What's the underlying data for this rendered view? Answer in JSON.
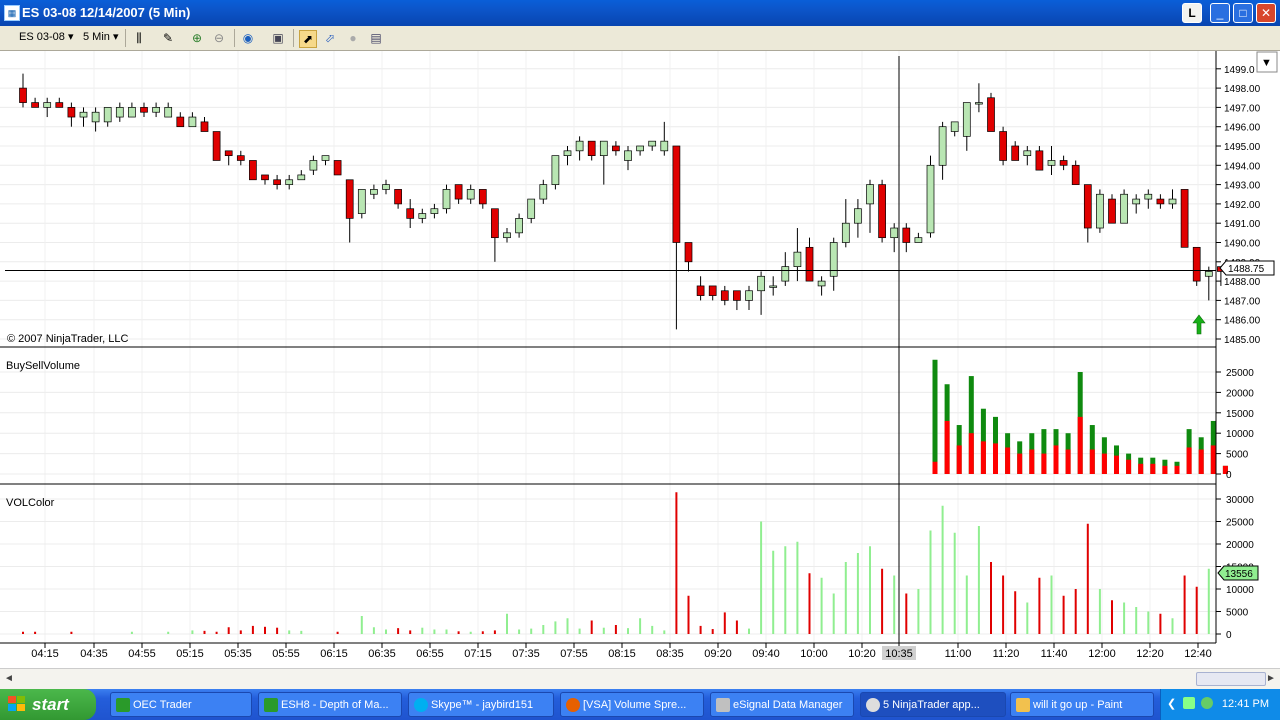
{
  "window": {
    "title": "ES 03-08  12/14/2007  (5 Min)",
    "l_button": "L",
    "minimize": "_",
    "maximize": "□",
    "close": "✕"
  },
  "toolbar": {
    "instrument": "ES 03-08",
    "interval": "5 Min",
    "icons": [
      "bar-type-icon",
      "pencil-icon",
      "zoom-in-icon",
      "zoom-out-icon",
      "globe-icon",
      "properties-icon",
      "data-box-icon",
      "indicators-icon",
      "strategies-icon",
      "grid-icon"
    ]
  },
  "chart": {
    "copyright": "© 2007 NinjaTrader, LLC",
    "price_label": "1488.75",
    "price_axis": [
      "1499.0",
      "1498.00",
      "1497.00",
      "1496.00",
      "1495.00",
      "1494.00",
      "1493.00",
      "1492.00",
      "1491.00",
      "1490.00",
      "1489.00",
      "1488.00",
      "1487.00",
      "1486.00",
      "1485.00"
    ],
    "time_axis": [
      "04:15",
      "04:35",
      "04:55",
      "05:15",
      "05:35",
      "05:55",
      "06:15",
      "06:35",
      "06:55",
      "07:15",
      "07:35",
      "07:55",
      "08:15",
      "08:35",
      "09:20",
      "09:40",
      "10:00",
      "10:20",
      "10:35",
      "11:00",
      "11:20",
      "11:40",
      "12:00",
      "12:20",
      "12:40"
    ],
    "cursor_time": "10:35",
    "panels": {
      "buysell": {
        "label": "BuySellVolume",
        "axis": [
          "25000",
          "20000",
          "15000",
          "10000",
          "5000",
          "0"
        ]
      },
      "volcolor": {
        "label": "VOLColor",
        "axis": [
          "30000",
          "25000",
          "20000",
          "15000",
          "10000",
          "5000",
          "0"
        ],
        "value_label": "13556"
      }
    },
    "colors": {
      "up": "#b9e6b3",
      "down": "#e00000",
      "vol_green": "#90ee90",
      "buy": "#0f8a0f",
      "sell": "#ff0000"
    }
  },
  "chart_data": [
    {
      "type": "candlestick",
      "title": "ES 03-08  12/14/2007  (5 Min)",
      "candles": [
        {
          "o": 1498.0,
          "h": 1498.75,
          "l": 1497.0,
          "c": 1497.25
        },
        {
          "o": 1497.25,
          "h": 1497.5,
          "l": 1497.0,
          "c": 1497.0
        },
        {
          "o": 1497.0,
          "h": 1497.5,
          "l": 1496.5,
          "c": 1497.25
        },
        {
          "o": 1497.25,
          "h": 1497.5,
          "l": 1497.0,
          "c": 1497.0
        },
        {
          "o": 1497.0,
          "h": 1497.25,
          "l": 1496.0,
          "c": 1496.5
        },
        {
          "o": 1496.5,
          "h": 1497.0,
          "l": 1496.0,
          "c": 1496.75
        },
        {
          "o": 1496.25,
          "h": 1497.0,
          "l": 1495.75,
          "c": 1496.75
        },
        {
          "o": 1496.25,
          "h": 1497.0,
          "l": 1496.0,
          "c": 1497.0
        },
        {
          "o": 1496.5,
          "h": 1497.25,
          "l": 1496.25,
          "c": 1497.0
        },
        {
          "o": 1496.5,
          "h": 1497.25,
          "l": 1496.5,
          "c": 1497.0
        },
        {
          "o": 1497.0,
          "h": 1497.25,
          "l": 1496.5,
          "c": 1496.75
        },
        {
          "o": 1496.75,
          "h": 1497.25,
          "l": 1496.5,
          "c": 1497.0
        },
        {
          "o": 1496.5,
          "h": 1497.25,
          "l": 1496.5,
          "c": 1497.0
        },
        {
          "o": 1496.5,
          "h": 1496.75,
          "l": 1496.0,
          "c": 1496.0
        },
        {
          "o": 1496.0,
          "h": 1496.75,
          "l": 1496.0,
          "c": 1496.5
        },
        {
          "o": 1496.25,
          "h": 1496.5,
          "l": 1495.75,
          "c": 1495.75
        },
        {
          "o": 1495.75,
          "h": 1495.75,
          "l": 1494.25,
          "c": 1494.25
        },
        {
          "o": 1494.75,
          "h": 1494.75,
          "l": 1494.0,
          "c": 1494.5
        },
        {
          "o": 1494.5,
          "h": 1494.75,
          "l": 1494.0,
          "c": 1494.25
        },
        {
          "o": 1494.25,
          "h": 1494.25,
          "l": 1493.25,
          "c": 1493.25
        },
        {
          "o": 1493.5,
          "h": 1493.5,
          "l": 1493.0,
          "c": 1493.25
        },
        {
          "o": 1493.25,
          "h": 1493.5,
          "l": 1492.75,
          "c": 1493.0
        },
        {
          "o": 1493.0,
          "h": 1493.5,
          "l": 1492.75,
          "c": 1493.25
        },
        {
          "o": 1493.25,
          "h": 1493.75,
          "l": 1493.25,
          "c": 1493.5
        },
        {
          "o": 1493.75,
          "h": 1494.5,
          "l": 1493.5,
          "c": 1494.25
        },
        {
          "o": 1494.25,
          "h": 1494.5,
          "l": 1494.0,
          "c": 1494.5
        },
        {
          "o": 1494.25,
          "h": 1494.25,
          "l": 1493.5,
          "c": 1493.5
        },
        {
          "o": 1493.25,
          "h": 1493.25,
          "l": 1490.0,
          "c": 1491.25
        },
        {
          "o": 1491.5,
          "h": 1492.75,
          "l": 1491.25,
          "c": 1492.75
        },
        {
          "o": 1492.5,
          "h": 1493.0,
          "l": 1492.25,
          "c": 1492.75
        },
        {
          "o": 1492.75,
          "h": 1493.25,
          "l": 1492.5,
          "c": 1493.0
        },
        {
          "o": 1492.75,
          "h": 1492.75,
          "l": 1491.75,
          "c": 1492.0
        },
        {
          "o": 1491.75,
          "h": 1492.25,
          "l": 1490.75,
          "c": 1491.25
        },
        {
          "o": 1491.25,
          "h": 1491.75,
          "l": 1491.0,
          "c": 1491.5
        },
        {
          "o": 1491.5,
          "h": 1492.0,
          "l": 1491.25,
          "c": 1491.75
        },
        {
          "o": 1491.75,
          "h": 1493.0,
          "l": 1491.5,
          "c": 1492.75
        },
        {
          "o": 1493.0,
          "h": 1493.0,
          "l": 1492.0,
          "c": 1492.25
        },
        {
          "o": 1492.25,
          "h": 1493.0,
          "l": 1492.0,
          "c": 1492.75
        },
        {
          "o": 1492.75,
          "h": 1492.75,
          "l": 1491.75,
          "c": 1492.0
        },
        {
          "o": 1491.75,
          "h": 1491.75,
          "l": 1489.0,
          "c": 1490.25
        },
        {
          "o": 1490.25,
          "h": 1490.75,
          "l": 1490.0,
          "c": 1490.5
        },
        {
          "o": 1490.5,
          "h": 1491.5,
          "l": 1490.25,
          "c": 1491.25
        },
        {
          "o": 1491.25,
          "h": 1492.25,
          "l": 1491.0,
          "c": 1492.25
        },
        {
          "o": 1492.25,
          "h": 1493.25,
          "l": 1492.0,
          "c": 1493.0
        },
        {
          "o": 1493.0,
          "h": 1494.5,
          "l": 1492.75,
          "c": 1494.5
        },
        {
          "o": 1494.5,
          "h": 1495.0,
          "l": 1494.0,
          "c": 1494.75
        },
        {
          "o": 1494.75,
          "h": 1495.5,
          "l": 1494.25,
          "c": 1495.25
        },
        {
          "o": 1495.25,
          "h": 1495.25,
          "l": 1494.25,
          "c": 1494.5
        },
        {
          "o": 1494.5,
          "h": 1495.25,
          "l": 1493.0,
          "c": 1495.25
        },
        {
          "o": 1495.0,
          "h": 1495.25,
          "l": 1494.5,
          "c": 1494.75
        },
        {
          "o": 1494.25,
          "h": 1495.0,
          "l": 1493.75,
          "c": 1494.75
        },
        {
          "o": 1494.75,
          "h": 1495.0,
          "l": 1494.5,
          "c": 1495.0
        },
        {
          "o": 1495.0,
          "h": 1495.25,
          "l": 1494.75,
          "c": 1495.25
        },
        {
          "o": 1494.75,
          "h": 1496.25,
          "l": 1494.5,
          "c": 1495.25
        },
        {
          "o": 1495.0,
          "h": 1495.0,
          "l": 1485.5,
          "c": 1490.0
        },
        {
          "o": 1490.0,
          "h": 1490.0,
          "l": 1488.5,
          "c": 1489.0
        },
        {
          "o": 1487.75,
          "h": 1488.25,
          "l": 1487.0,
          "c": 1487.25
        },
        {
          "o": 1487.75,
          "h": 1487.75,
          "l": 1487.0,
          "c": 1487.25
        },
        {
          "o": 1487.5,
          "h": 1487.75,
          "l": 1486.75,
          "c": 1487.0
        },
        {
          "o": 1487.5,
          "h": 1487.5,
          "l": 1486.5,
          "c": 1487.0
        },
        {
          "o": 1487.0,
          "h": 1487.75,
          "l": 1486.5,
          "c": 1487.5
        },
        {
          "o": 1487.5,
          "h": 1488.5,
          "l": 1486.25,
          "c": 1488.25
        },
        {
          "o": 1487.75,
          "h": 1488.25,
          "l": 1487.25,
          "c": 1487.75
        },
        {
          "o": 1488.0,
          "h": 1489.5,
          "l": 1487.75,
          "c": 1488.75
        },
        {
          "o": 1488.75,
          "h": 1490.75,
          "l": 1488.0,
          "c": 1489.5
        },
        {
          "o": 1489.75,
          "h": 1490.25,
          "l": 1488.0,
          "c": 1488.0
        },
        {
          "o": 1487.75,
          "h": 1488.25,
          "l": 1487.25,
          "c": 1488.0
        },
        {
          "o": 1488.25,
          "h": 1490.25,
          "l": 1487.5,
          "c": 1490.0
        },
        {
          "o": 1490.0,
          "h": 1492.25,
          "l": 1489.75,
          "c": 1491.0
        },
        {
          "o": 1491.0,
          "h": 1492.25,
          "l": 1490.25,
          "c": 1491.75
        },
        {
          "o": 1492.0,
          "h": 1493.25,
          "l": 1490.5,
          "c": 1493.0
        },
        {
          "o": 1493.0,
          "h": 1493.25,
          "l": 1490.0,
          "c": 1490.25
        },
        {
          "o": 1490.25,
          "h": 1491.0,
          "l": 1489.5,
          "c": 1490.75
        },
        {
          "o": 1490.75,
          "h": 1491.0,
          "l": 1489.5,
          "c": 1490.0
        },
        {
          "o": 1490.0,
          "h": 1490.5,
          "l": 1490.0,
          "c": 1490.25
        },
        {
          "o": 1490.5,
          "h": 1494.5,
          "l": 1490.25,
          "c": 1494.0
        },
        {
          "o": 1494.0,
          "h": 1496.25,
          "l": 1493.25,
          "c": 1496.0
        },
        {
          "o": 1495.75,
          "h": 1496.25,
          "l": 1495.5,
          "c": 1496.25
        },
        {
          "o": 1495.5,
          "h": 1497.25,
          "l": 1494.75,
          "c": 1497.25
        },
        {
          "o": 1497.25,
          "h": 1498.25,
          "l": 1496.75,
          "c": 1497.25
        },
        {
          "o": 1497.5,
          "h": 1497.75,
          "l": 1495.75,
          "c": 1495.75
        },
        {
          "o": 1495.75,
          "h": 1496.0,
          "l": 1494.0,
          "c": 1494.25
        },
        {
          "o": 1495.0,
          "h": 1495.25,
          "l": 1494.25,
          "c": 1494.25
        },
        {
          "o": 1494.5,
          "h": 1495.0,
          "l": 1494.0,
          "c": 1494.75
        },
        {
          "o": 1494.75,
          "h": 1495.0,
          "l": 1493.75,
          "c": 1493.75
        },
        {
          "o": 1494.0,
          "h": 1495.0,
          "l": 1493.5,
          "c": 1494.25
        },
        {
          "o": 1494.25,
          "h": 1494.5,
          "l": 1493.75,
          "c": 1494.0
        },
        {
          "o": 1494.0,
          "h": 1494.25,
          "l": 1493.0,
          "c": 1493.0
        },
        {
          "o": 1493.0,
          "h": 1493.0,
          "l": 1490.0,
          "c": 1490.75
        },
        {
          "o": 1490.75,
          "h": 1492.75,
          "l": 1490.5,
          "c": 1492.5
        },
        {
          "o": 1492.25,
          "h": 1492.5,
          "l": 1491.0,
          "c": 1491.0
        },
        {
          "o": 1491.0,
          "h": 1492.75,
          "l": 1491.0,
          "c": 1492.5
        },
        {
          "o": 1492.0,
          "h": 1492.5,
          "l": 1491.5,
          "c": 1492.25
        },
        {
          "o": 1492.25,
          "h": 1492.75,
          "l": 1491.75,
          "c": 1492.5
        },
        {
          "o": 1492.25,
          "h": 1492.5,
          "l": 1491.75,
          "c": 1492.0
        },
        {
          "o": 1492.0,
          "h": 1492.75,
          "l": 1491.75,
          "c": 1492.25
        },
        {
          "o": 1492.75,
          "h": 1492.75,
          "l": 1490.0,
          "c": 1489.75
        },
        {
          "o": 1489.75,
          "h": 1489.75,
          "l": 1487.75,
          "c": 1488.0
        },
        {
          "o": 1488.25,
          "h": 1488.75,
          "l": 1487.0,
          "c": 1488.5
        },
        {
          "o": 1488.75,
          "h": 1488.75,
          "l": 1487.75,
          "c": 1488.5
        }
      ],
      "ylim": [
        1485,
        1499
      ]
    },
    {
      "type": "bar",
      "title": "BuySellVolume",
      "series": [
        {
          "name": "buy",
          "values": [
            28000,
            22000,
            12000,
            24000,
            16000,
            14000,
            10000,
            8000,
            10000,
            11000,
            11000,
            10000,
            25000,
            12000,
            9000,
            7000,
            5000,
            4000,
            4000,
            3500,
            3000,
            11000,
            9000,
            13000,
            2000
          ]
        },
        {
          "name": "sell",
          "values": [
            3000,
            13000,
            7000,
            10000,
            8000,
            7500,
            6500,
            5000,
            6000,
            5000,
            7000,
            6000,
            14000,
            6000,
            5000,
            4500,
            3500,
            2500,
            2500,
            2000,
            2000,
            6500,
            6000,
            7000,
            2000
          ]
        }
      ],
      "ylim": [
        0,
        28000
      ]
    },
    {
      "type": "bar",
      "title": "VOLColor",
      "values": [
        500,
        500,
        0,
        0,
        500,
        0,
        0,
        0,
        0,
        500,
        0,
        0,
        500,
        0,
        800,
        700,
        500,
        1500,
        800,
        1800,
        1600,
        1400,
        800,
        700,
        0,
        0,
        500,
        0,
        4000,
        1500,
        1000,
        1300,
        800,
        1400,
        1000,
        1000,
        600,
        500,
        600,
        800,
        4500,
        1000,
        1200,
        2000,
        2800,
        3500,
        1200,
        3000,
        1400,
        2000,
        1300,
        3500,
        1800,
        800,
        31500,
        8500,
        1800,
        1100,
        4800,
        3000,
        1200,
        25000,
        18500,
        19500,
        20500,
        13500,
        12500,
        9000,
        16000,
        18000,
        19500,
        14500,
        13000,
        9000,
        10000,
        23000,
        28500,
        22500,
        13000,
        24000,
        16000,
        13000,
        9500,
        7000,
        12500,
        13000,
        8500,
        10000,
        24500,
        10000,
        7500,
        7000,
        6000,
        5000,
        4500,
        3500,
        13000,
        10500,
        14500
      ],
      "value_label": 13556,
      "ylim": [
        0,
        32000
      ]
    }
  ],
  "scrollbar": {
    "left_arrow": "◄",
    "right_arrow": "►"
  },
  "taskbar": {
    "start_label": "start",
    "tasks": [
      "OEC Trader",
      "ESH8 - Depth of Ma...",
      "Skype™ - jaybird151",
      "[VSA] Volume Spre...",
      "eSignal Data Manager",
      "5 NinjaTrader app...",
      "will it go up - Paint"
    ],
    "clock": "12:41 PM"
  }
}
